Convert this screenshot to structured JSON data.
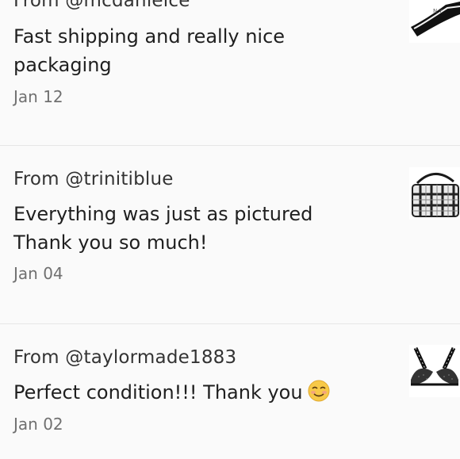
{
  "reviews": [
    {
      "from": "From @mcdanielce",
      "message": "Fast shipping and really nice packaging",
      "date": "Jan 12",
      "thumbnail": "sweater-item-thumbnail"
    },
    {
      "from": "From @trinitiblue",
      "message_line1": "Everything was just as pictured",
      "message_line2": "Thank you so much!",
      "date": "Jan 04",
      "thumbnail": "plaid-handbag-thumbnail"
    },
    {
      "from": "From @taylormade1883",
      "message": "Perfect condition!!! Thank you",
      "emoji": "smiling-face-emoji",
      "date": "Jan 02",
      "thumbnail": "black-bra-thumbnail"
    }
  ],
  "colors": {
    "background": "#fafafa",
    "divider": "#e6e6e6",
    "text": "#1f1f1f",
    "date": "#707070"
  }
}
